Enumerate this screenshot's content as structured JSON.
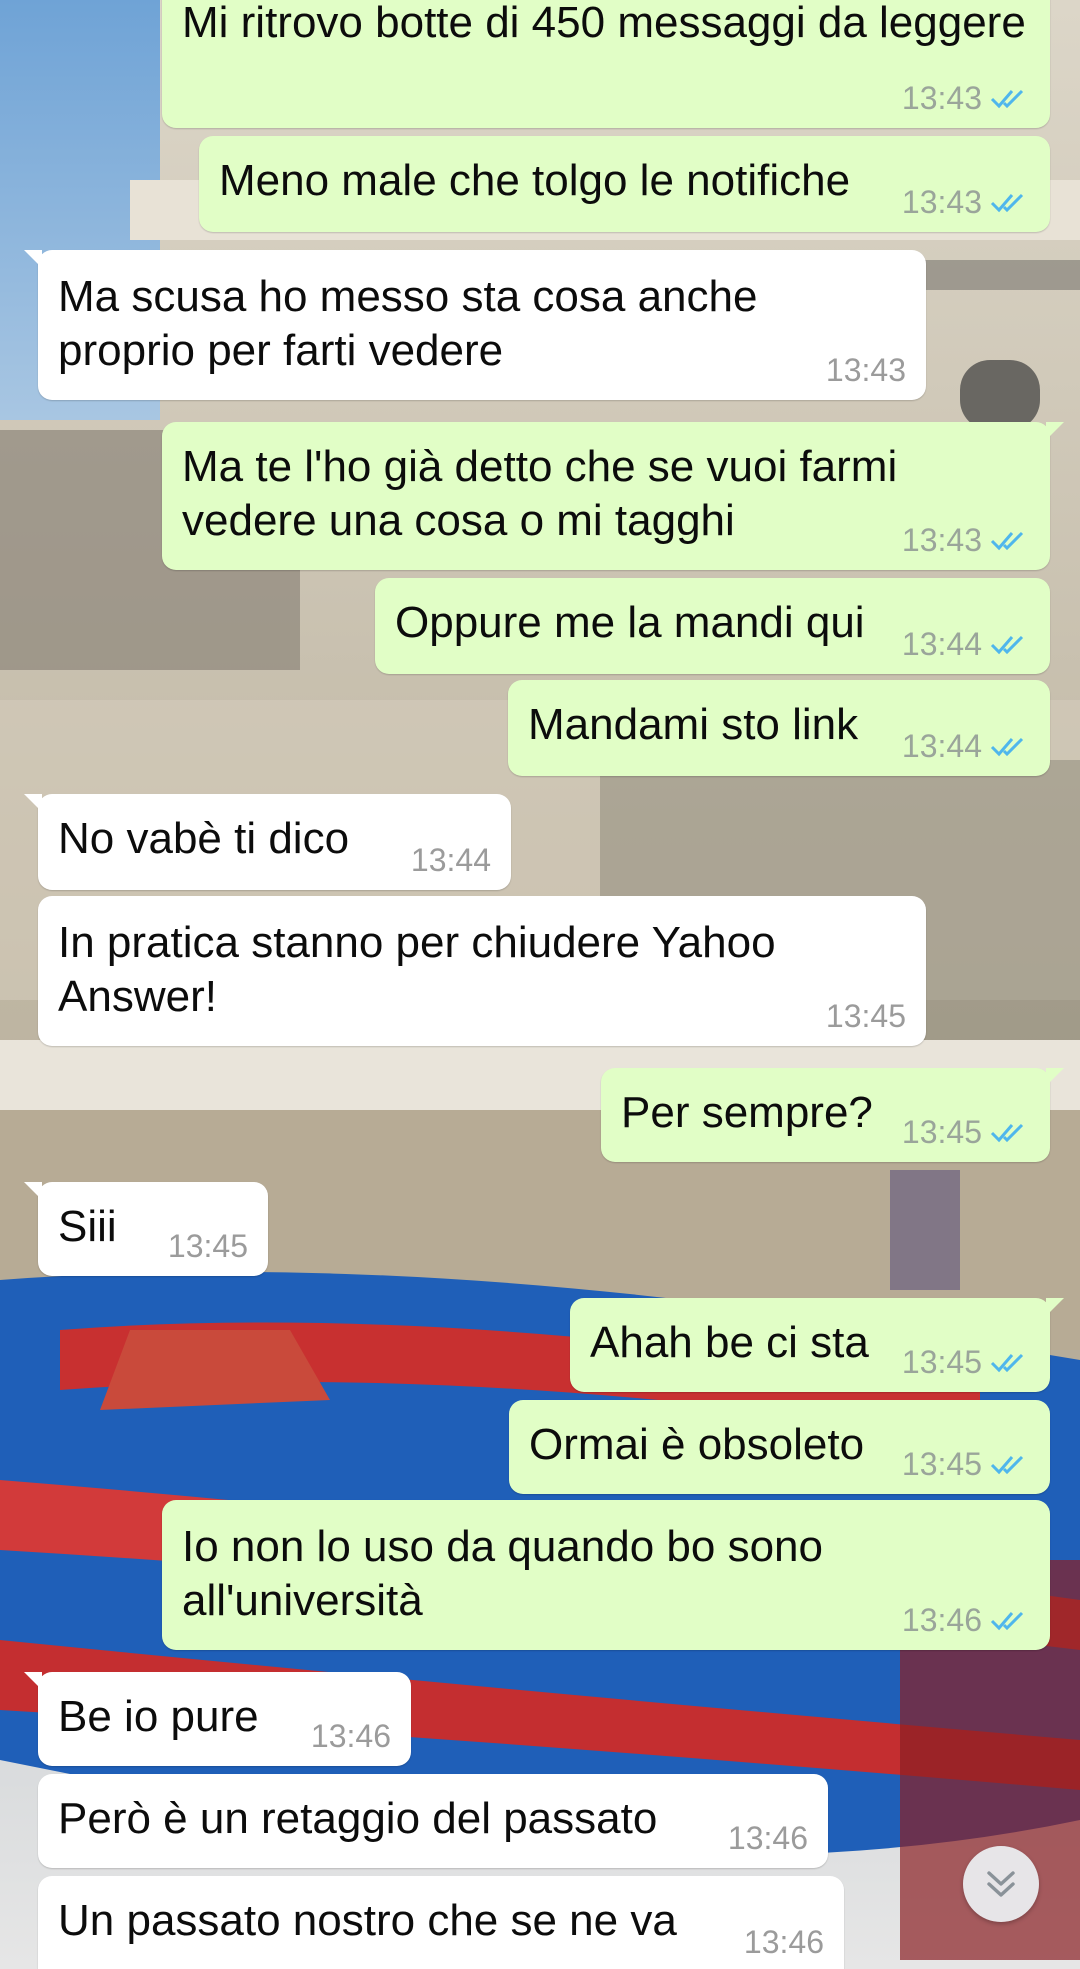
{
  "chat": {
    "messages": [
      {
        "dir": "out",
        "text": "Mi ritrovo botte di 450 messaggi da leggere",
        "time": "13:43",
        "read": true
      },
      {
        "dir": "out",
        "text": "Meno male che tolgo le notifiche",
        "time": "13:43",
        "read": true
      },
      {
        "dir": "in",
        "text": "Ma scusa ho messo sta cosa anche proprio per farti vedere",
        "time": "13:43"
      },
      {
        "dir": "out",
        "text": "Ma te l'ho già detto che se vuoi farmi vedere una cosa o mi tagghi",
        "time": "13:43",
        "read": true
      },
      {
        "dir": "out",
        "text": "Oppure me la mandi qui",
        "time": "13:44",
        "read": true
      },
      {
        "dir": "out",
        "text": "Mandami sto link",
        "time": "13:44",
        "read": true
      },
      {
        "dir": "in",
        "text": "No vabè ti dico",
        "time": "13:44"
      },
      {
        "dir": "in",
        "text": "In pratica stanno per chiudere Yahoo Answer!",
        "time": "13:45"
      },
      {
        "dir": "out",
        "text": "Per sempre?",
        "time": "13:45",
        "read": true
      },
      {
        "dir": "in",
        "text": "Siii",
        "time": "13:45"
      },
      {
        "dir": "out",
        "text": "Ahah be ci sta",
        "time": "13:45",
        "read": true
      },
      {
        "dir": "out",
        "text": "Ormai è obsoleto",
        "time": "13:45",
        "read": true
      },
      {
        "dir": "out",
        "text": "Io non lo uso da quando bo sono all'università",
        "time": "13:46",
        "read": true
      },
      {
        "dir": "in",
        "text": "Be io pure",
        "time": "13:46"
      },
      {
        "dir": "in",
        "text": "Però è un retaggio del passato",
        "time": "13:46"
      },
      {
        "dir": "in",
        "text": "Un passato nostro che se ne va",
        "time": "13:46"
      }
    ]
  },
  "colors": {
    "outgoing_bubble": "#e1fec6",
    "incoming_bubble": "#ffffff",
    "read_ticks": "#4fb6ec",
    "time_text": "#9b9b9b"
  },
  "icons": {
    "read_receipt": "double-check-icon",
    "scroll_button": "chevron-double-down-icon"
  }
}
